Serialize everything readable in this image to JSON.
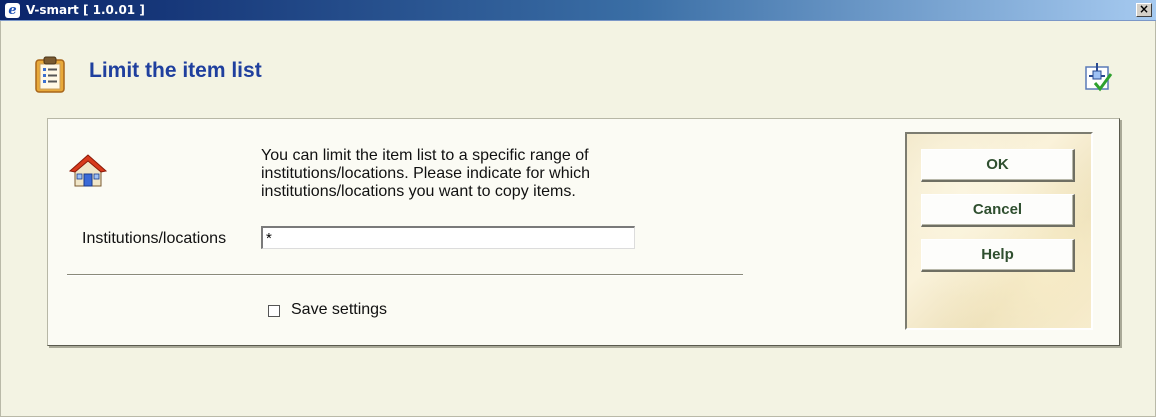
{
  "window": {
    "title": "V-smart [ 1.0.01 ]",
    "close_label": "×",
    "app_icon_glyph": "e"
  },
  "header": {
    "title": "Limit the item list",
    "left_icon": "clipboard-list-icon",
    "right_icon": "workflow-check-icon"
  },
  "form": {
    "home_icon": "house-icon",
    "instructions": "You can limit the item list to a specific range of institutions/locations. Please indicate for which institutions/locations you want to copy items.",
    "field_label": "Institutions/locations",
    "field_value": "*",
    "save_settings_label": "Save settings",
    "save_settings_checked": false
  },
  "buttons": {
    "ok": "OK",
    "cancel": "Cancel",
    "help": "Help"
  },
  "colors": {
    "title_blue": "#1f3f9e",
    "background": "#f3f3e3",
    "panel": "#fbfbf4",
    "button_text": "#2f4f2f"
  }
}
